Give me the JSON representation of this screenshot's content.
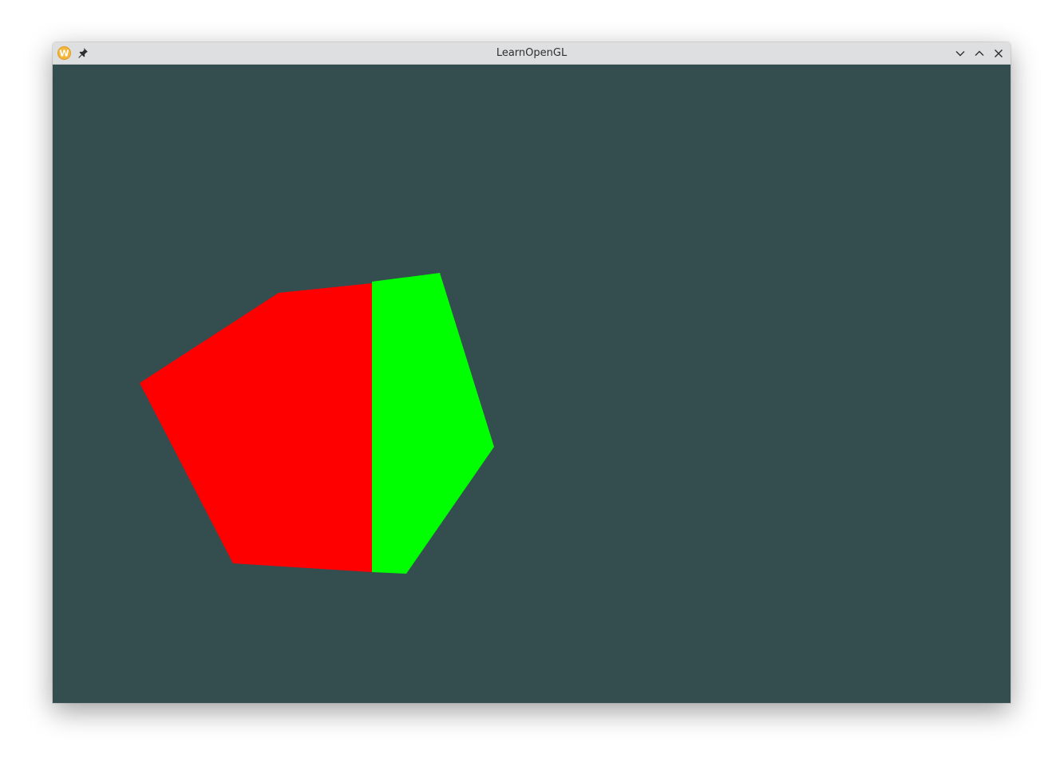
{
  "window": {
    "title": "LearnOpenGL",
    "app_icon": "wayland-w-icon",
    "pin_icon": "pin-icon",
    "controls": [
      "minimize-icon",
      "maximize-icon",
      "close-icon"
    ]
  },
  "scene": {
    "clear_color": "#344d4e",
    "shapes": [
      {
        "name": "red-polygon",
        "color": "#ff0000"
      },
      {
        "name": "green-polygon",
        "color": "#00ff00"
      }
    ]
  }
}
